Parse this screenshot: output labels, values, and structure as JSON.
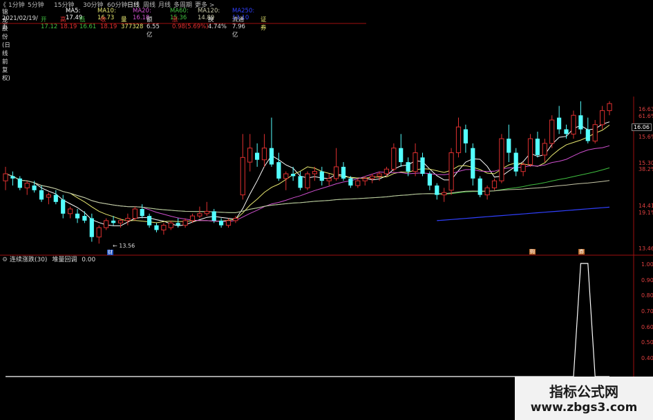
{
  "toolbar": {
    "items": [
      "1分钟",
      "5分钟",
      "15分钟",
      "30分钟",
      "60分钟",
      "日线",
      "周线",
      "月线",
      "多周期",
      "更多 >"
    ],
    "active": "日线",
    "back_label": "《 "
  },
  "info1": {
    "stock": "锦龙股份(日线 前复权)",
    "ma5": "MA5: 17.49",
    "ma10": "MA10: 16.73",
    "ma20": "MA20: 16.18",
    "ma60": "MA60: 15.36",
    "ma120": "MA120: 14.89",
    "ma250": "MA250: 13.10"
  },
  "info2": {
    "date": "2021/02/19/五",
    "open": "开17.12",
    "high": "高18.19",
    "low": "低16.61",
    "close": "收18.19",
    "volume": "量377328",
    "amount": "额6.55亿",
    "change": "涨0.98(5.69%)",
    "turnover": "换4.74%",
    "float": "流通7.96亿",
    "tag": "证券"
  },
  "indicator": {
    "name": "连续涨跌(30)",
    "sub": "堆量回调",
    "value": "0.00"
  },
  "price_axis": [
    "16.63",
    "61.6%",
    "16.06",
    "15.6%",
    "15.30",
    "38.2%",
    "14.41",
    "19.1%",
    "13.46"
  ],
  "indicator_axis": [
    "1.00",
    "0.90",
    "0.80",
    "0.70",
    "0.60",
    "0.50",
    "0.40"
  ],
  "annotations": {
    "low_marker": "13.56",
    "current_price": "16.06",
    "bottom_tag1": "财",
    "bottom_tag2": "购",
    "bottom_tag3": "券"
  },
  "watermark": {
    "line1": "指标公式网",
    "line2": "www.zbgs3.com"
  },
  "colors": {
    "up": "#e03030",
    "down": "#54ffff",
    "ma5": "#ffffff",
    "ma10": "#e8e870",
    "ma20": "#d050d0",
    "ma60": "#40c040",
    "ma120": "#c8c8a8",
    "ma250": "#3040ff",
    "border": "#a01010"
  },
  "chart_data": {
    "type": "candlestick",
    "ylim": [
      13.46,
      16.7
    ],
    "candles": [
      {
        "o": 14.9,
        "h": 15.2,
        "l": 14.7,
        "c": 15.05
      },
      {
        "o": 15.0,
        "h": 15.1,
        "l": 14.8,
        "c": 14.95
      },
      {
        "o": 14.95,
        "h": 15.0,
        "l": 14.7,
        "c": 14.75
      },
      {
        "o": 14.75,
        "h": 14.9,
        "l": 14.6,
        "c": 14.85
      },
      {
        "o": 14.8,
        "h": 14.9,
        "l": 14.65,
        "c": 14.7
      },
      {
        "o": 14.7,
        "h": 14.8,
        "l": 14.45,
        "c": 14.5
      },
      {
        "o": 14.55,
        "h": 14.65,
        "l": 14.4,
        "c": 14.6
      },
      {
        "o": 14.6,
        "h": 14.7,
        "l": 14.4,
        "c": 14.45
      },
      {
        "o": 14.5,
        "h": 14.6,
        "l": 14.1,
        "c": 14.2
      },
      {
        "o": 14.2,
        "h": 14.35,
        "l": 14.1,
        "c": 14.3
      },
      {
        "o": 14.2,
        "h": 14.3,
        "l": 14.0,
        "c": 14.1
      },
      {
        "o": 14.15,
        "h": 14.25,
        "l": 14.0,
        "c": 14.05
      },
      {
        "o": 14.1,
        "h": 14.2,
        "l": 13.6,
        "c": 13.7
      },
      {
        "o": 13.7,
        "h": 13.95,
        "l": 13.56,
        "c": 13.9
      },
      {
        "o": 13.9,
        "h": 14.1,
        "l": 13.85,
        "c": 14.05
      },
      {
        "o": 14.05,
        "h": 14.15,
        "l": 13.95,
        "c": 14.0
      },
      {
        "o": 14.0,
        "h": 14.1,
        "l": 13.9,
        "c": 14.05
      },
      {
        "o": 14.05,
        "h": 14.2,
        "l": 13.95,
        "c": 14.1
      },
      {
        "o": 14.1,
        "h": 14.35,
        "l": 14.05,
        "c": 14.3
      },
      {
        "o": 14.3,
        "h": 14.4,
        "l": 14.1,
        "c": 14.15
      },
      {
        "o": 14.15,
        "h": 14.2,
        "l": 13.9,
        "c": 13.95
      },
      {
        "o": 13.95,
        "h": 14.0,
        "l": 13.8,
        "c": 13.85
      },
      {
        "o": 13.85,
        "h": 14.0,
        "l": 13.75,
        "c": 13.95
      },
      {
        "o": 13.9,
        "h": 14.05,
        "l": 13.85,
        "c": 14.0
      },
      {
        "o": 14.0,
        "h": 14.1,
        "l": 13.9,
        "c": 13.95
      },
      {
        "o": 13.95,
        "h": 14.1,
        "l": 13.9,
        "c": 14.05
      },
      {
        "o": 14.05,
        "h": 14.2,
        "l": 14.0,
        "c": 14.15
      },
      {
        "o": 14.15,
        "h": 14.35,
        "l": 14.1,
        "c": 14.2
      },
      {
        "o": 14.2,
        "h": 14.45,
        "l": 14.15,
        "c": 14.25
      },
      {
        "o": 14.25,
        "h": 14.3,
        "l": 14.0,
        "c": 14.05
      },
      {
        "o": 14.05,
        "h": 14.1,
        "l": 13.9,
        "c": 13.95
      },
      {
        "o": 13.95,
        "h": 14.1,
        "l": 13.9,
        "c": 14.05
      },
      {
        "o": 14.05,
        "h": 14.15,
        "l": 14.0,
        "c": 14.1
      },
      {
        "o": 14.6,
        "h": 15.9,
        "l": 14.5,
        "c": 15.4
      },
      {
        "o": 15.3,
        "h": 15.9,
        "l": 15.1,
        "c": 15.6
      },
      {
        "o": 15.5,
        "h": 15.7,
        "l": 15.2,
        "c": 15.35
      },
      {
        "o": 15.35,
        "h": 15.9,
        "l": 15.2,
        "c": 15.6
      },
      {
        "o": 15.6,
        "h": 16.25,
        "l": 15.2,
        "c": 15.25
      },
      {
        "o": 15.3,
        "h": 15.5,
        "l": 14.9,
        "c": 14.95
      },
      {
        "o": 14.95,
        "h": 15.1,
        "l": 14.7,
        "c": 15.05
      },
      {
        "o": 15.05,
        "h": 15.2,
        "l": 14.9,
        "c": 15.0
      },
      {
        "o": 15.0,
        "h": 15.1,
        "l": 14.7,
        "c": 14.75
      },
      {
        "o": 14.75,
        "h": 15.1,
        "l": 14.7,
        "c": 15.05
      },
      {
        "o": 15.05,
        "h": 15.2,
        "l": 14.9,
        "c": 15.1
      },
      {
        "o": 15.1,
        "h": 15.2,
        "l": 14.8,
        "c": 14.9
      },
      {
        "o": 14.9,
        "h": 15.05,
        "l": 14.8,
        "c": 14.95
      },
      {
        "o": 14.95,
        "h": 15.6,
        "l": 14.9,
        "c": 15.2
      },
      {
        "o": 15.2,
        "h": 15.3,
        "l": 14.9,
        "c": 14.95
      },
      {
        "o": 14.95,
        "h": 15.0,
        "l": 14.75,
        "c": 14.8
      },
      {
        "o": 14.8,
        "h": 14.95,
        "l": 14.75,
        "c": 14.9
      },
      {
        "o": 14.9,
        "h": 15.0,
        "l": 14.8,
        "c": 14.95
      },
      {
        "o": 14.95,
        "h": 15.05,
        "l": 14.85,
        "c": 15.0
      },
      {
        "o": 15.0,
        "h": 15.1,
        "l": 14.9,
        "c": 15.05
      },
      {
        "o": 15.05,
        "h": 15.2,
        "l": 15.0,
        "c": 15.15
      },
      {
        "o": 15.15,
        "h": 15.7,
        "l": 15.1,
        "c": 15.6
      },
      {
        "o": 15.6,
        "h": 15.9,
        "l": 15.2,
        "c": 15.3
      },
      {
        "o": 15.3,
        "h": 15.4,
        "l": 15.0,
        "c": 15.1
      },
      {
        "o": 15.1,
        "h": 15.7,
        "l": 15.0,
        "c": 15.5
      },
      {
        "o": 15.4,
        "h": 15.5,
        "l": 15.0,
        "c": 15.05
      },
      {
        "o": 15.05,
        "h": 15.1,
        "l": 14.7,
        "c": 14.8
      },
      {
        "o": 14.8,
        "h": 14.85,
        "l": 14.5,
        "c": 14.6
      },
      {
        "o": 14.6,
        "h": 14.75,
        "l": 14.45,
        "c": 14.65
      },
      {
        "o": 14.7,
        "h": 15.6,
        "l": 14.6,
        "c": 15.5
      },
      {
        "o": 15.5,
        "h": 16.25,
        "l": 15.4,
        "c": 16.05
      },
      {
        "o": 16.0,
        "h": 16.1,
        "l": 15.5,
        "c": 15.7
      },
      {
        "o": 15.6,
        "h": 15.7,
        "l": 14.8,
        "c": 14.95
      },
      {
        "o": 14.95,
        "h": 15.0,
        "l": 14.55,
        "c": 14.6
      },
      {
        "o": 14.6,
        "h": 14.8,
        "l": 14.5,
        "c": 14.75
      },
      {
        "o": 14.75,
        "h": 14.95,
        "l": 14.7,
        "c": 14.9
      },
      {
        "o": 14.9,
        "h": 15.9,
        "l": 14.85,
        "c": 15.8
      },
      {
        "o": 15.8,
        "h": 16.1,
        "l": 15.3,
        "c": 15.5
      },
      {
        "o": 15.5,
        "h": 15.6,
        "l": 15.0,
        "c": 15.1
      },
      {
        "o": 15.1,
        "h": 15.3,
        "l": 15.0,
        "c": 15.25
      },
      {
        "o": 15.25,
        "h": 15.9,
        "l": 15.2,
        "c": 15.8
      },
      {
        "o": 15.8,
        "h": 15.95,
        "l": 15.4,
        "c": 15.45
      },
      {
        "o": 15.45,
        "h": 15.8,
        "l": 15.3,
        "c": 15.7
      },
      {
        "o": 15.7,
        "h": 16.3,
        "l": 15.6,
        "c": 16.2
      },
      {
        "o": 16.25,
        "h": 16.5,
        "l": 15.9,
        "c": 16.0
      },
      {
        "o": 16.0,
        "h": 16.1,
        "l": 15.8,
        "c": 15.9
      },
      {
        "o": 15.9,
        "h": 16.4,
        "l": 15.8,
        "c": 16.3
      },
      {
        "o": 16.3,
        "h": 16.6,
        "l": 15.9,
        "c": 16.0
      },
      {
        "o": 16.0,
        "h": 16.25,
        "l": 15.7,
        "c": 15.75
      },
      {
        "o": 15.75,
        "h": 16.2,
        "l": 15.7,
        "c": 16.1
      },
      {
        "o": 16.1,
        "h": 16.5,
        "l": 16.0,
        "c": 16.4
      },
      {
        "o": 16.4,
        "h": 16.6,
        "l": 16.3,
        "c": 16.55
      }
    ],
    "indicator_values": [
      0,
      0,
      0,
      0,
      0,
      0,
      0,
      0,
      0,
      0,
      0,
      0,
      0,
      0,
      0,
      0,
      0,
      0,
      0,
      0,
      0,
      0,
      0,
      0,
      0,
      0,
      0,
      0,
      0,
      0,
      0,
      0,
      0,
      0,
      0,
      0,
      0,
      0,
      0,
      0,
      0,
      0,
      0,
      0,
      0,
      0,
      0,
      0,
      0,
      0,
      0,
      0,
      0,
      0,
      0,
      0,
      0,
      0,
      0,
      0,
      0,
      0,
      0,
      0,
      0,
      0,
      0,
      0,
      0,
      0,
      0,
      0,
      0,
      0,
      0,
      0,
      0,
      0,
      0,
      0,
      1,
      1,
      0,
      0,
      0
    ]
  }
}
